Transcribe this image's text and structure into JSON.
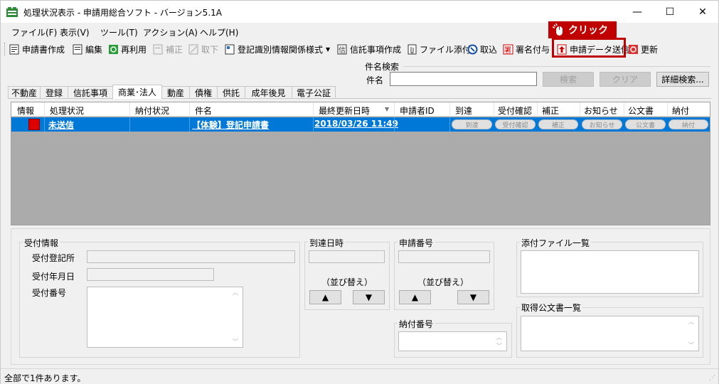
{
  "window": {
    "title": "処理状況表示 - 申請用総合ソフト - バージョン5.1A",
    "minimize": "—",
    "maximize": "☐",
    "close": "✕"
  },
  "menu": [
    "ファイル(F)",
    "表示(V)",
    "ツール(T)",
    "アクション(A)",
    "ヘルプ(H)"
  ],
  "toolbar": {
    "create_application": "申請書作成",
    "edit": "編集",
    "reuse": "再利用",
    "amend": "補正",
    "withdraw": "取下",
    "registration_info": "登記識別情報関係様式",
    "trust_create": "信託事項作成",
    "file_attach": "ファイル添付",
    "import": "取込",
    "signature": "署名付与",
    "send_data": "申請データ送信",
    "refresh": "更新"
  },
  "callout": {
    "label": "クリック"
  },
  "search": {
    "group_label": "件名検索",
    "name_label": "件名",
    "name_value": "",
    "search_button": "検索",
    "clear_button": "クリア",
    "detail_button": "詳細検索..."
  },
  "tabs": [
    "不動産",
    "登録",
    "信託事項",
    "商業･法人",
    "動産",
    "債権",
    "供託",
    "成年後見",
    "電子公証"
  ],
  "active_tab": "商業･法人",
  "grid": {
    "columns": [
      "情報",
      "処理状況",
      "納付状況",
      "件名",
      "最終更新日時",
      "申請者ID",
      "到達",
      "受付確認",
      "補正",
      "お知らせ",
      "公文書",
      "納付"
    ],
    "row": {
      "status": "未送信",
      "payment_status": "",
      "subject": "【体験】登記申請書",
      "updated": "2018/03/26 11:49",
      "applicant_id": "",
      "btn_arrival": "到達",
      "btn_receipt": "受付確認",
      "btn_amend": "補正",
      "btn_notice": "お知らせ",
      "btn_official": "公文書",
      "btn_payment": "納付"
    }
  },
  "lower": {
    "reception_group": "受付情報",
    "reception_office": "受付登記所",
    "reception_date": "受付年月日",
    "reception_number": "受付番号",
    "arrival_group": "到達日時",
    "sort_label_1": "（並び替え）",
    "app_number_group": "申請番号",
    "sort_label_2": "（並び替え）",
    "up_arrow": "▲",
    "down_arrow": "▼",
    "payment_group": "納付番号",
    "attach_list_group": "添付ファイル一覧",
    "official_doc_group": "取得公文書一覧"
  },
  "status": {
    "text": "全部で1件あります。"
  }
}
